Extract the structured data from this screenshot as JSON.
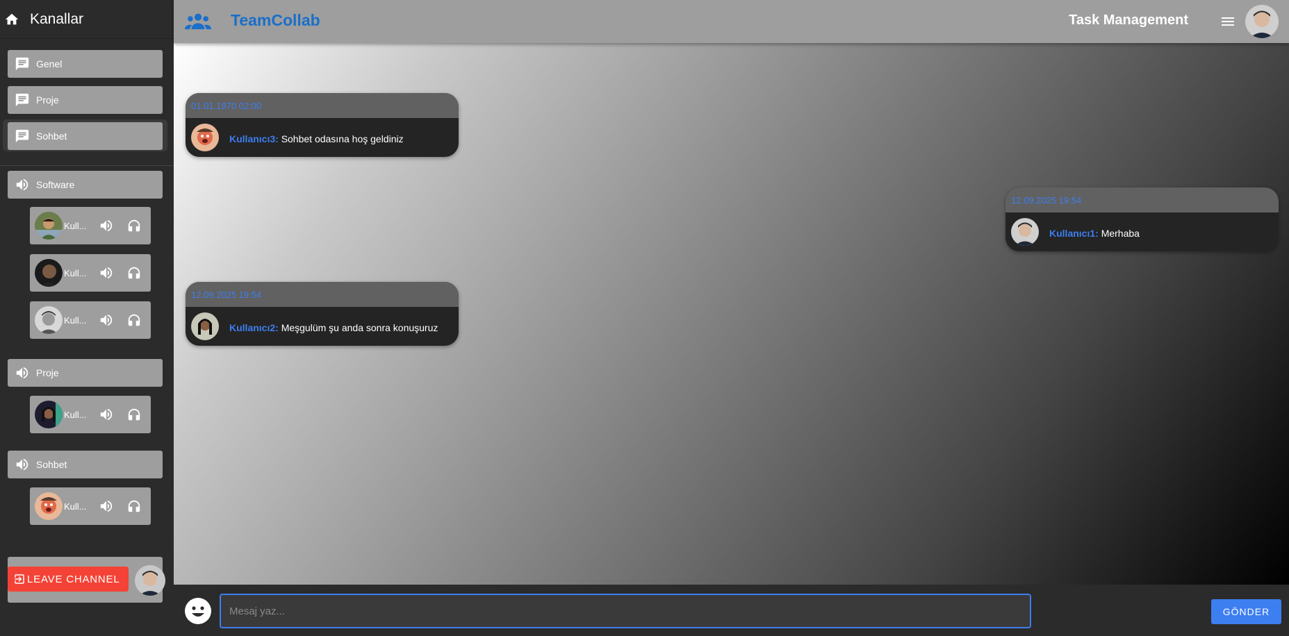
{
  "sidebar": {
    "title": "Kanallar",
    "text_channels": [
      {
        "label": "Genel",
        "icon": "chat-icon"
      },
      {
        "label": "Proje",
        "icon": "chat-icon"
      },
      {
        "label": "Sohbet",
        "icon": "chat-icon",
        "active": true
      }
    ],
    "voice_channels": [
      {
        "label": "Software",
        "icon": "volume-icon",
        "users": [
          {
            "name": "Kull...",
            "avatar": "avatar-green"
          },
          {
            "name": "Kull...",
            "avatar": "avatar-dark"
          },
          {
            "name": "Kull...",
            "avatar": "avatar-gray"
          }
        ]
      },
      {
        "label": "Proje",
        "icon": "volume-icon",
        "users": [
          {
            "name": "Kull...",
            "avatar": "avatar-teal"
          }
        ]
      },
      {
        "label": "Sohbet",
        "icon": "volume-icon",
        "users": [
          {
            "name": "Kull...",
            "avatar": "avatar-orange"
          }
        ]
      }
    ],
    "leave_button": "LEAVE CHANNEL"
  },
  "topbar": {
    "brand": "TeamCollab",
    "section_title": "Task Management",
    "brand_color": "#1a6fc9"
  },
  "messages": [
    {
      "timestamp": "01.01.1970 02:00",
      "sender": "Kullanıcı3:",
      "text": "Sohbet odasına hoş geldiniz",
      "align": "left"
    },
    {
      "timestamp": "12.09.2025 19:54",
      "sender": "Kullanıcı1:",
      "text": "Merhaba",
      "align": "right"
    },
    {
      "timestamp": "12.09.2025 19:54",
      "sender": "Kullanıcı2:",
      "text": "Meşgulüm şu anda sonra konuşuruz",
      "align": "left"
    }
  ],
  "input": {
    "placeholder": "Mesaj yaz...",
    "value": "",
    "send_label": "GÖNDER"
  },
  "colors": {
    "accent": "#3d7ef0",
    "danger": "#f44336",
    "panel": "#9e9e9e"
  }
}
